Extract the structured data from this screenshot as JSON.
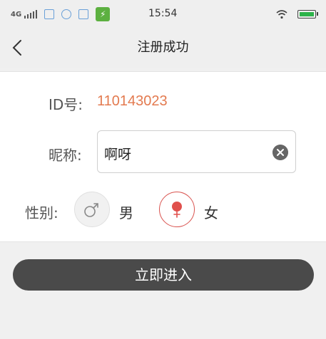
{
  "status_bar": {
    "network": "4G",
    "time": "15:54",
    "usb_icon_text": "⚡"
  },
  "nav": {
    "title": "注册成功"
  },
  "form": {
    "id_label": "ID号:",
    "id_value": "110143023",
    "nickname_label": "昵称:",
    "nickname_value": "啊呀",
    "gender_label": "性别:",
    "gender_options": [
      {
        "label": "男",
        "icon": "male-icon",
        "selected": false
      },
      {
        "label": "女",
        "icon": "female-icon",
        "selected": true
      }
    ]
  },
  "actions": {
    "enter_label": "立即进入"
  },
  "colors": {
    "accent_orange": "#e37a4f",
    "female_red": "#d9534f",
    "button_dark": "#4a4a4a"
  }
}
